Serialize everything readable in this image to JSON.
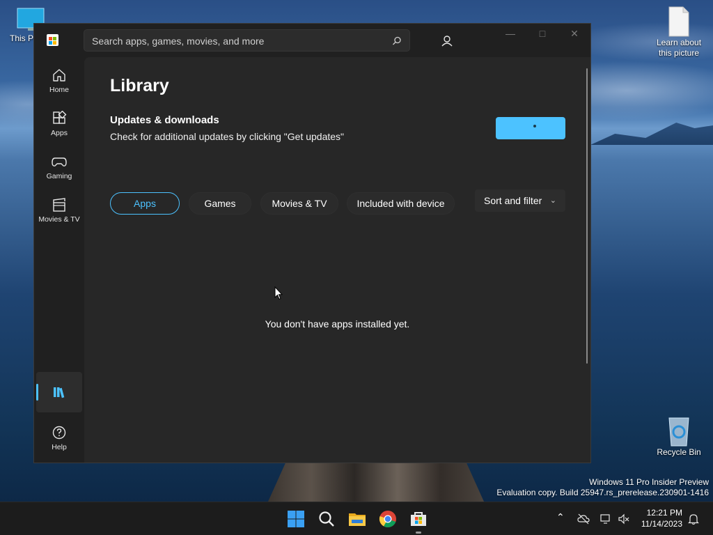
{
  "desktop": {
    "icons": [
      {
        "label": "This P"
      },
      {
        "label": "Learn about this picture"
      },
      {
        "label": "Recycle Bin"
      }
    ],
    "watermark": {
      "line1": "Windows 11 Pro Insider Preview",
      "line2": "Evaluation copy. Build 25947.rs_prerelease.230901-1416"
    }
  },
  "store": {
    "search": {
      "placeholder": "Search apps, games, movies, and more"
    },
    "nav": [
      {
        "label": "Home",
        "icon": "home-icon"
      },
      {
        "label": "Apps",
        "icon": "apps-icon"
      },
      {
        "label": "Gaming",
        "icon": "controller-icon"
      },
      {
        "label": "Movies & TV",
        "icon": "clapperboard-icon"
      },
      {
        "label": "",
        "icon": "library-icon"
      },
      {
        "label": "Help",
        "icon": "help-icon"
      }
    ],
    "page_title": "Library",
    "updates": {
      "title": "Updates & downloads",
      "description": "Check for additional updates by clicking \"Get updates\"",
      "button_state": "loading"
    },
    "filters": [
      {
        "label": "Apps",
        "selected": true
      },
      {
        "label": "Games",
        "selected": false
      },
      {
        "label": "Movies & TV",
        "selected": false
      },
      {
        "label": "Included with device",
        "selected": false
      }
    ],
    "sort_label": "Sort and filter",
    "empty_message": "You don't have apps installed yet.",
    "accent_color": "#4cc2ff"
  },
  "taskbar": {
    "apps": [
      "start-icon",
      "search-icon",
      "file-explorer-icon",
      "chrome-icon",
      "store-icon"
    ],
    "clock": {
      "time": "12:21 PM",
      "date": "11/14/2023"
    }
  }
}
